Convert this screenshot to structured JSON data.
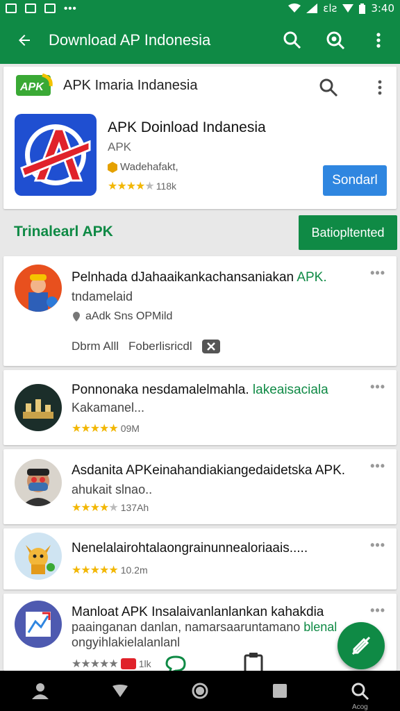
{
  "status": {
    "time": "3:40",
    "carrier": "ɛlƨ"
  },
  "toolbar": {
    "title": "Download AP Indonesia"
  },
  "featured": {
    "brand": "APK Imaria Indanesia",
    "logo_text": "APK",
    "app_title": "APK Doinload Indanesia",
    "app_sub": "APK",
    "developer": "Wadehafakt,",
    "rating_text": "118k",
    "install_label": "Sondarl"
  },
  "section": {
    "title": "Trinalearl APK",
    "button_label": "Batiopltented"
  },
  "items": [
    {
      "title": "Pelnhada dJahaaikankachansaniakan",
      "title_accent": "APK.",
      "line2": "tndamelaid",
      "line3": "aAdk Sns OPMild",
      "tag_text": "Dbrm Alll",
      "tag2_text": "Foberlisricdl"
    },
    {
      "title": "Ponnonaka nesdamalelmahla.",
      "title_accent": "lakeaisaciala",
      "line2": "Kakamanel...",
      "rating": "09M"
    },
    {
      "title": "Asdanita APKeinahandiakiangedaidetska APK.",
      "line2": "ahukait slnao..",
      "rating": "137Ah"
    },
    {
      "title": "Nenelalairohtalaongrainunnealoriaais.....",
      "rating": "10.2m"
    },
    {
      "title": "Manloat APK Insalaivanlanlankan kahakdia",
      "line2": "paainganan danlan, namarsaaruntamano",
      "line2_accent": "blenal",
      "line3": "ongyihlakielalanlanl",
      "rating": "1lk"
    }
  ],
  "navbar": {
    "search_label": "Acog"
  }
}
